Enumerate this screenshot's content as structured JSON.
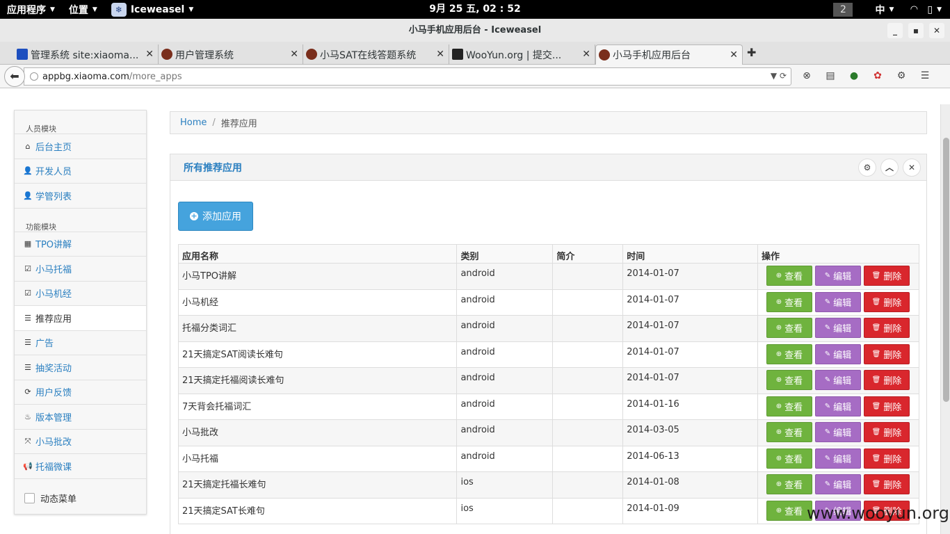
{
  "topbar": {
    "apps_menu": "应用程序",
    "places_menu": "位置",
    "app_name": "Iceweasel",
    "clock": "9月 25 五, 02 : 52",
    "workspace": "2",
    "input_method": "中"
  },
  "window": {
    "title": "小马手机应用后台 - Iceweasel"
  },
  "tabs": [
    {
      "label": "管理系统 site:xiaoma...",
      "active": false
    },
    {
      "label": "用户管理系统",
      "active": false
    },
    {
      "label": "小马SAT在线答题系统",
      "active": false
    },
    {
      "label": "WooYun.org | 提交...",
      "active": false
    },
    {
      "label": "小马手机应用后台",
      "active": true
    }
  ],
  "url": {
    "host": "appbg.xiaoma.com",
    "path": "/more_apps"
  },
  "sidebar": {
    "section1": "人员模块",
    "items1": [
      {
        "label": "后台主页",
        "icon": "home-icon",
        "glyph": "⌂"
      },
      {
        "label": "开发人员",
        "icon": "user-icon",
        "glyph": "👤"
      },
      {
        "label": "学管列表",
        "icon": "user-icon",
        "glyph": "👤"
      }
    ],
    "section2": "功能模块",
    "items2": [
      {
        "label": "TPO讲解",
        "icon": "film-icon",
        "glyph": "▦"
      },
      {
        "label": "小马托福",
        "icon": "edit-icon",
        "glyph": "☑"
      },
      {
        "label": "小马机经",
        "icon": "edit-icon",
        "glyph": "☑"
      },
      {
        "label": "推荐应用",
        "icon": "list-icon",
        "glyph": "☰",
        "active": true
      },
      {
        "label": "广告",
        "icon": "list-icon",
        "glyph": "☰"
      },
      {
        "label": "抽奖活动",
        "icon": "list-icon",
        "glyph": "☰"
      },
      {
        "label": "用户反馈",
        "icon": "refresh-icon",
        "glyph": "⟳"
      },
      {
        "label": "版本管理",
        "icon": "fire-icon",
        "glyph": "♨"
      },
      {
        "label": "小马批改",
        "icon": "fullscreen-icon",
        "glyph": "⤧"
      },
      {
        "label": "托福微课",
        "icon": "bullhorn-icon",
        "glyph": "📢"
      }
    ],
    "dynamic_menu_label": "动态菜单"
  },
  "breadcrumb": {
    "home": "Home",
    "separator": "/",
    "current": "推荐应用"
  },
  "panel": {
    "title": "所有推荐应用",
    "add_button": "添加应用"
  },
  "table": {
    "headers": [
      "应用名称",
      "类别",
      "简介",
      "时间",
      "操作"
    ],
    "rows": [
      {
        "name": "小马TPO讲解",
        "type": "android",
        "intro": "",
        "date": "2014-01-07"
      },
      {
        "name": "小马机经",
        "type": "android",
        "intro": "",
        "date": "2014-01-07"
      },
      {
        "name": "托福分类词汇",
        "type": "android",
        "intro": "",
        "date": "2014-01-07"
      },
      {
        "name": "21天搞定SAT阅读长难句",
        "type": "android",
        "intro": "",
        "date": "2014-01-07"
      },
      {
        "name": "21天搞定托福阅读长难句",
        "type": "android",
        "intro": "",
        "date": "2014-01-07"
      },
      {
        "name": "7天背会托福词汇",
        "type": "android",
        "intro": "",
        "date": "2014-01-16"
      },
      {
        "name": "小马批改",
        "type": "android",
        "intro": "",
        "date": "2014-03-05"
      },
      {
        "name": "小马托福",
        "type": "android",
        "intro": "",
        "date": "2014-06-13"
      },
      {
        "name": "21天搞定托福长难句",
        "type": "ios",
        "intro": "",
        "date": "2014-01-08"
      },
      {
        "name": "21天搞定SAT长难句",
        "type": "ios",
        "intro": "",
        "date": "2014-01-09"
      }
    ],
    "actions": {
      "view": "查看",
      "edit": "编辑",
      "delete": "删除"
    }
  },
  "watermark": "www.wooyun.org",
  "colors": {
    "accent": "#2a7fc0",
    "view": "#6fb33e",
    "edit": "#a66cc4",
    "delete": "#d9272d",
    "add": "#45a3dd"
  }
}
